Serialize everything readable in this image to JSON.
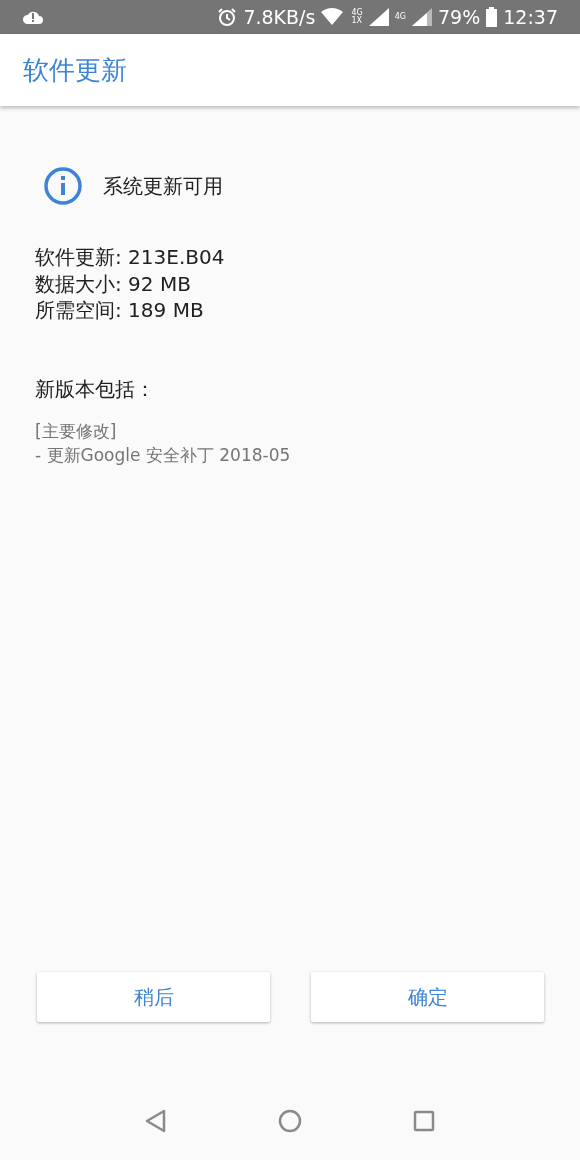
{
  "status_bar": {
    "speed": "7.8KB/s",
    "sim1_top": "4G",
    "sim1_bottom": "1X",
    "sim2": "4G",
    "battery": "79%",
    "time": "12:37"
  },
  "app_bar": {
    "title": "软件更新"
  },
  "notice": {
    "text": "系统更新可用"
  },
  "details": [
    "软件更新: 213E.B04",
    "数据大小: 92 MB",
    "所需空间: 189 MB"
  ],
  "changelog": {
    "heading": "新版本包括：",
    "lines": [
      "[主要修改]",
      "- 更新Google 安全补丁 2018-05"
    ]
  },
  "buttons": [
    {
      "label": "稍后"
    },
    {
      "label": "确定"
    }
  ]
}
